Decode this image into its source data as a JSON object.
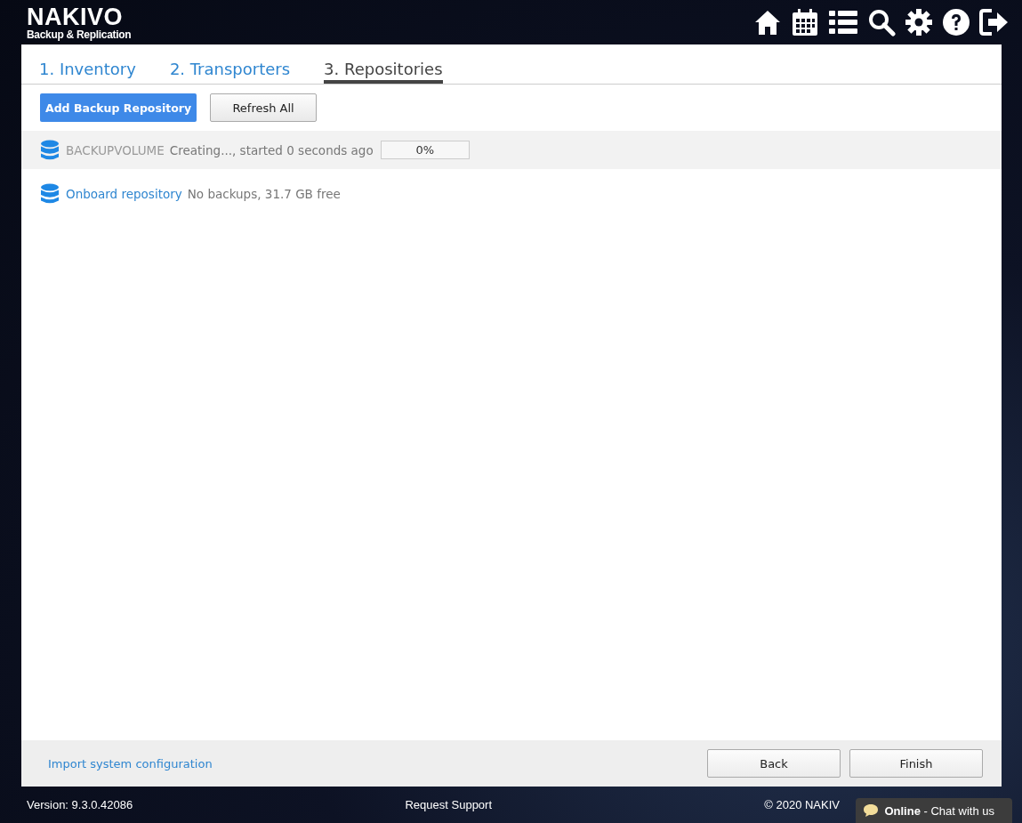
{
  "header": {
    "logo_title": "NAKIVO",
    "logo_subtitle": "Backup & Replication"
  },
  "tabs": [
    {
      "label": "1. Inventory",
      "selected": false
    },
    {
      "label": "2. Transporters",
      "selected": false
    },
    {
      "label": "3. Repositories",
      "selected": true
    }
  ],
  "toolbar": {
    "buttons": [
      {
        "label": "Add Backup Repository",
        "kind": "primary"
      },
      {
        "label": "Refresh All",
        "kind": "secondary"
      }
    ]
  },
  "repositories": [
    {
      "name": "BACKUPVOLUME",
      "status": "Creating..., started 0 seconds ago",
      "kind": "creating",
      "level": 0,
      "reading": "0%"
    },
    {
      "name": "Onboard repository",
      "status": "No backups, 31.7 GB free",
      "kind": "ready"
    }
  ],
  "bottom_bar": {
    "link": "Import system configuration",
    "buttons": [
      "Back",
      "Finish"
    ]
  },
  "footer": {
    "version": "Version: 9.3.0.42086",
    "support": "Request Support",
    "copyright": "© 2020 NAKIV",
    "chat": "**Online** - Chat with us"
  }
}
